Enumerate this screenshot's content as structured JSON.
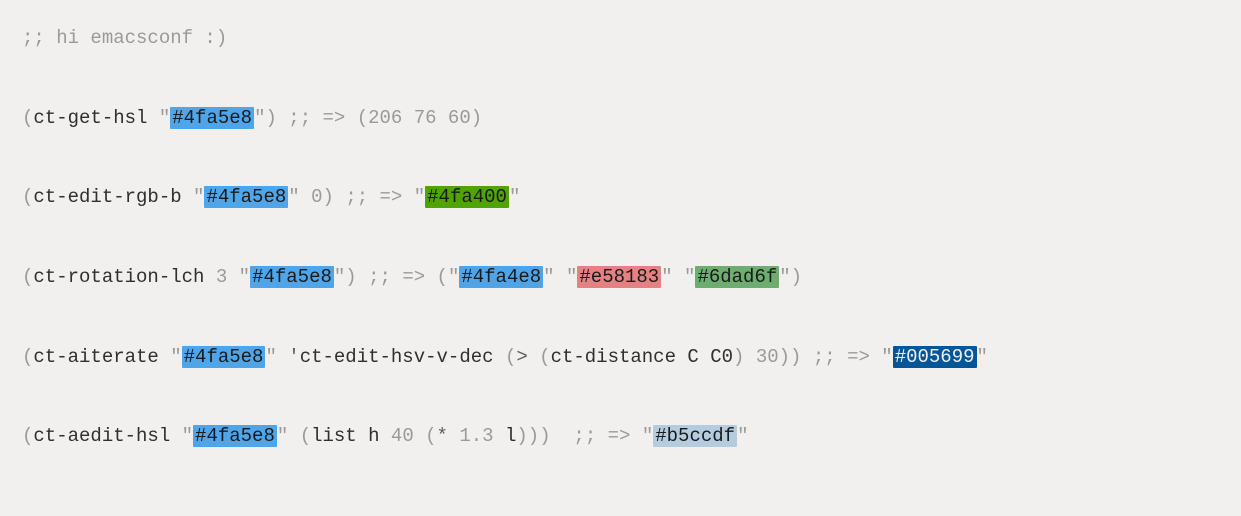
{
  "line1": {
    "comment": ";; hi emacsconf :)"
  },
  "line2": {
    "p1": "(",
    "fn": "ct-get-hsl",
    "sp": " ",
    "q1": "\"",
    "color": "#4fa5e8",
    "q2": "\"",
    "p2": ")",
    "sp2": " ",
    "comment": ";; => (206 76 60)"
  },
  "line3": {
    "p1": "(",
    "fn": "ct-edit-rgb-b",
    "sp": " ",
    "q1": "\"",
    "color": "#4fa5e8",
    "q2": "\"",
    "sp2": " ",
    "arg": "0",
    "p2": ")",
    "sp3": " ",
    "cm1": ";; => ",
    "rq1": "\"",
    "rcolor": "#4fa400",
    "rq2": "\""
  },
  "line4": {
    "p1": "(",
    "fn": "ct-rotation-lch",
    "sp": " ",
    "arg": "3",
    "sp2": " ",
    "q1": "\"",
    "color": "#4fa5e8",
    "q2": "\"",
    "p2": ")",
    "sp3": " ",
    "cm1": ";; => (",
    "rq1a": "\"",
    "rcolor1": "#4fa4e8",
    "rq1b": "\"",
    "rsp1": " ",
    "rq2a": "\"",
    "rcolor2": "#e58183",
    "rq2b": "\"",
    "rsp2": " ",
    "rq3a": "\"",
    "rcolor3": "#6dad6f",
    "rq3b": "\"",
    "cm2": ")"
  },
  "line5": {
    "p1": "(",
    "fn": "ct-aiterate",
    "sp": " ",
    "q1": "\"",
    "color": "#4fa5e8",
    "q2": "\"",
    "sp2": " ",
    "tick": "'",
    "sym": "ct-edit-hsv-v-dec",
    "sp3": " ",
    "p2": "(",
    "gt": ">",
    "sp4": " ",
    "p3": "(",
    "fn2": "ct-distance",
    "sp5": " ",
    "a1": "C",
    "sp6": " ",
    "a2": "C0",
    "p4": ")",
    "sp7": " ",
    "num": "30",
    "p5": "))",
    "sp8": " ",
    "cm1": ";; => ",
    "rq1": "\"",
    "rcolor": "#005699",
    "rq2": "\""
  },
  "line6": {
    "p1": "(",
    "fn": "ct-aedit-hsl",
    "sp": " ",
    "q1": "\"",
    "color": "#4fa5e8",
    "q2": "\"",
    "sp2": " ",
    "p2": "(",
    "fn2": "list",
    "sp3": " ",
    "a1": "h",
    "sp4": " ",
    "a2": "40",
    "sp5": " ",
    "p3": "(",
    "star": "*",
    "sp6": " ",
    "a3": "1.3",
    "sp7": " ",
    "a4": "l",
    "p4": ")))",
    "sp8": "  ",
    "cm1": ";; => ",
    "rq1": "\"",
    "rcolor": "#b5ccdf",
    "rq2": "\""
  }
}
